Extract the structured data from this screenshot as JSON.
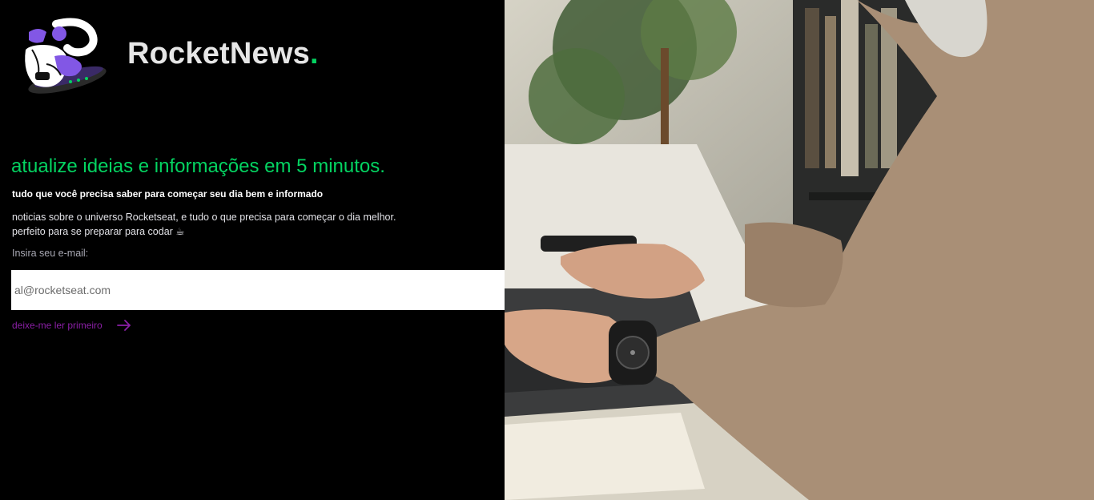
{
  "brand": {
    "name": "RocketNews",
    "dot": ".",
    "dot_color": "#04d361"
  },
  "hero": {
    "headline": "atualize ideias e informações em 5 minutos.",
    "subheadline": "tudo que você precisa saber para começar seu dia bem e informado",
    "description_line1": "noticias sobre o universo Rocketseat, e tudo o que precisa para começar o dia melhor.",
    "description_line2": "perfeito para se preparar para codar ☕"
  },
  "form": {
    "email_label": "Insira seu e-mail:",
    "email_placeholder": "al@rocketseat.com",
    "email_value": "",
    "submit_icon": "send-icon",
    "read_first_label": "deixe-me ler primeiro",
    "read_first_icon": "arrow-right-icon"
  },
  "colors": {
    "accent_green": "#04d361",
    "accent_purple": "#8257e5",
    "link_purple": "#8b1fa6",
    "background": "#000000"
  },
  "photo": {
    "subject": "person typing on laptop wearing wristwatch",
    "icon": "photo"
  }
}
